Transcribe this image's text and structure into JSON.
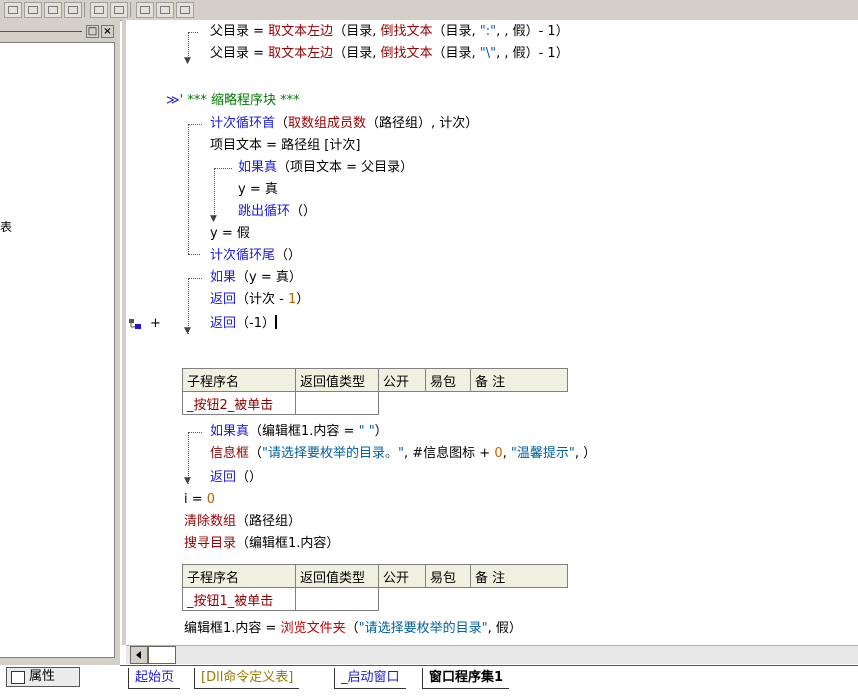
{
  "panel": {
    "clipped_text": "表",
    "attr_tab_label": "属性",
    "close_glyph": "×",
    "max_glyph": "□"
  },
  "code": {
    "l1": {
      "a": "父目录 = ",
      "b": "取文本左边",
      "c": "（目录, ",
      "d": "倒找文本",
      "e": "（目录, ",
      "f": "\":\"",
      "g": ", , 假）- 1）"
    },
    "l2": {
      "a": "父目录 = ",
      "b": "取文本左边",
      "c": "（目录, ",
      "d": "倒找文本",
      "e": "（目录, ",
      "f": "\"\\\"",
      "g": ", , 假）- 1）"
    },
    "comment_marker": "≫",
    "comment": "' *** 缩略程序块 ***",
    "l4": {
      "a": "计次循环首",
      "b": "（",
      "c": "取数组成员数",
      "d": "（路径组）, 计次）"
    },
    "l5": "项目文本 = 路径组 [计次]",
    "l6": {
      "a": "如果真",
      "b": "（项目文本 = 父目录）"
    },
    "l7": "y = 真",
    "l8": {
      "a": "跳出循环",
      "b": "（）"
    },
    "l9": "y = 假",
    "l10": {
      "a": "计次循环尾",
      "b": "（）"
    },
    "l11": {
      "a": "如果",
      "b": "（y = 真）"
    },
    "l12": {
      "a": "返回",
      "b": "（计次 - ",
      "c": "1",
      "d": "）"
    },
    "l13": {
      "a": "返回",
      "b": "（-1）"
    },
    "gutter_plus": "+",
    "t1": {
      "headers": [
        "子程序名",
        "返回值类型",
        "公开",
        "易包",
        "备 注"
      ],
      "name": "_按钮2_被单击"
    },
    "l14": {
      "a": "如果真",
      "b": "（编辑框1.内容 = ",
      "c": "\" \"",
      "d": "）"
    },
    "l15": {
      "a": "信息框",
      "b": "（",
      "c": "\"请选择要枚举的目录。\"",
      "d": ", #信息图标 + ",
      "e": "0",
      "f": ", ",
      "g": "\"温馨提示\"",
      "h": ", ）"
    },
    "l16": {
      "a": "返回",
      "b": "（）"
    },
    "l17": {
      "a": "i = ",
      "b": "0"
    },
    "l18": {
      "a": "清除数组",
      "b": "（路径组）"
    },
    "l19": {
      "a": "搜寻目录",
      "b": "（编辑框1.内容）"
    },
    "t2": {
      "headers": [
        "子程序名",
        "返回值类型",
        "公开",
        "易包",
        "备 注"
      ],
      "name": "_按钮1_被单击"
    },
    "l20": {
      "a": "编辑框1.内容 = ",
      "b": "浏览文件夹",
      "c": "（",
      "d": "\"请选择要枚举的目录\"",
      "e": ", 假）"
    }
  },
  "tabs": [
    "起始页",
    "[Dll命令定义表]",
    "_启动窗口",
    "窗口程序集1"
  ]
}
